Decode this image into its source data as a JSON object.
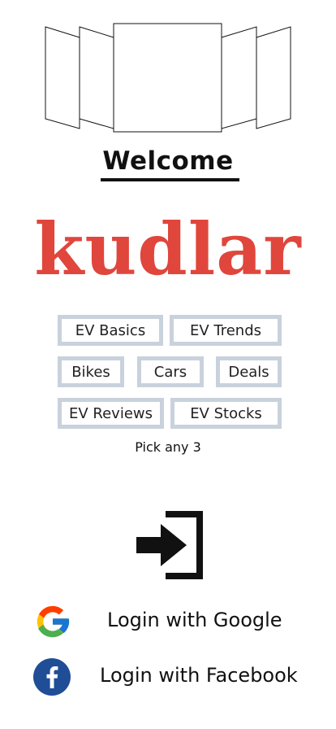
{
  "header": {
    "welcome": "Welcome"
  },
  "brand": {
    "logo": "kudlar",
    "color": "#e0463c"
  },
  "topics": {
    "chips": [
      "EV Basics",
      "EV Trends",
      "Bikes",
      "Cars",
      "Deals",
      "EV Reviews",
      "EV Stocks"
    ],
    "hint": "Pick any 3"
  },
  "login": {
    "icon": "sign-in-icon",
    "google_label": "Login with Google",
    "facebook_label": "Login with Facebook",
    "facebook_color": "#1f4e96"
  }
}
